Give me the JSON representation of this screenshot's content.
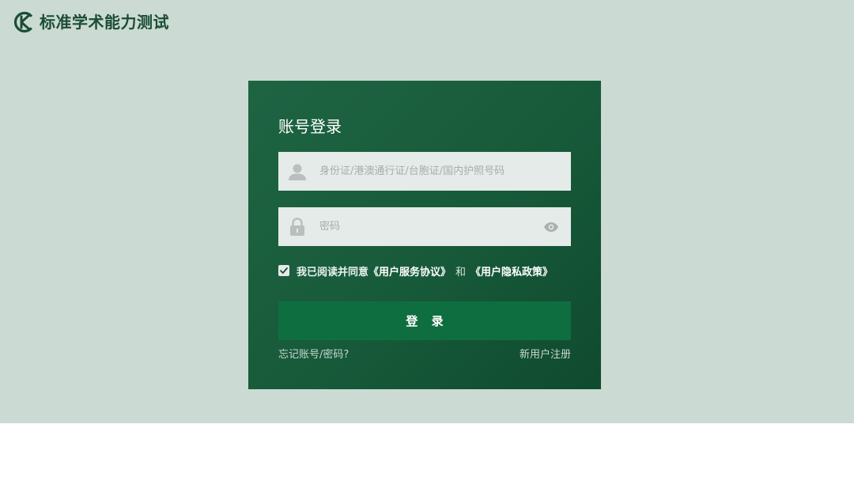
{
  "brand": {
    "title": "标准学术能力测试",
    "logo_icon": "sk-monogram-icon"
  },
  "login": {
    "title": "账号登录",
    "id_field": {
      "placeholder": "身份证/港澳通行证/台胞证/国内护照号码",
      "value": "",
      "icon": "user-icon"
    },
    "password_field": {
      "placeholder": "密码",
      "value": "",
      "icon": "lock-icon",
      "toggle_icon": "eye-icon"
    },
    "agreement": {
      "checked": true,
      "prefix": "我已阅读并同意",
      "user_agreement": "《用户服务协议》",
      "and": "和",
      "privacy_policy": "《用户隐私政策》"
    },
    "submit_label": "登 录",
    "forgot_link": "忘记账号/密码?",
    "register_link": "新用户注册"
  },
  "colors": {
    "page_background": "#cbdad3",
    "panel_background": "#175a3a",
    "button_background": "#0f6e3f",
    "brand_text": "#1b4d35",
    "input_background": "#e5ebe8"
  }
}
